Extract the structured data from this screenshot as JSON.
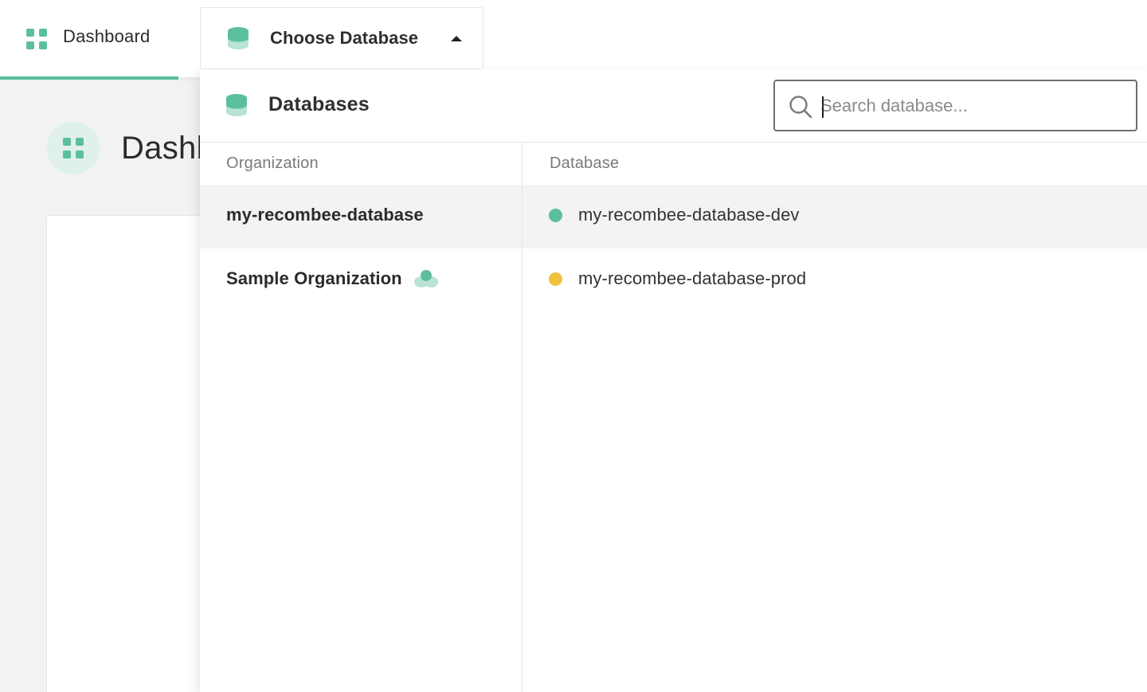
{
  "nav": {
    "dashboard_label": "Dashboard",
    "dashboard_icon": "dashboard-grid-icon"
  },
  "db_selector": {
    "label": "Choose Database",
    "icon": "database-icon",
    "caret_icon": "caret-up-icon"
  },
  "page": {
    "title": "Dashb"
  },
  "panel": {
    "title": "Databases",
    "icon": "database-icon",
    "search": {
      "placeholder": "Search database...",
      "value": "",
      "icon": "search-icon"
    },
    "columns": {
      "organization": "Organization",
      "database": "Database"
    },
    "organizations": [
      {
        "name": "my-recombee-database",
        "selected": true
      },
      {
        "name": "Sample Organization",
        "icon": "sample-organization-icon",
        "selected": false
      }
    ],
    "databases": [
      {
        "name": "my-recombee-database-dev",
        "status_color": "#5cbf9b"
      },
      {
        "name": "my-recombee-database-prod",
        "status_color": "#f0c13a"
      }
    ]
  },
  "colors": {
    "accent": "#5cbf9b",
    "accent_light": "#dff1ea",
    "warning": "#f0c13a"
  }
}
